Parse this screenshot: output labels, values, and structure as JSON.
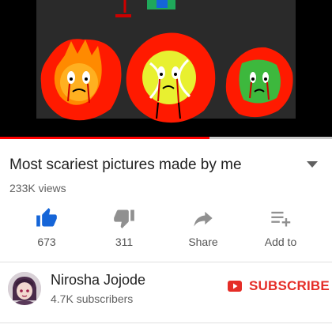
{
  "video": {
    "title": "Most scariest pictures made by me",
    "views": "233K views",
    "progress_fraction": 0.63
  },
  "actions": [
    {
      "icon": "thumbs-up-icon",
      "label": "673"
    },
    {
      "icon": "thumbs-down-icon",
      "label": "311"
    },
    {
      "icon": "share-icon",
      "label": "Share"
    },
    {
      "icon": "add-to-playlist-icon",
      "label": "Add to"
    }
  ],
  "channel": {
    "name": "Nirosha Jojode",
    "subscribers": "4.7K subscribers",
    "subscribe_label": "SUBSCRIBE"
  },
  "colors": {
    "accent_blue": "#1565d8",
    "icon_gray": "#909090",
    "subscribe_red": "#e52d27",
    "progress_red": "#ff0000",
    "player_background": "#000000"
  }
}
